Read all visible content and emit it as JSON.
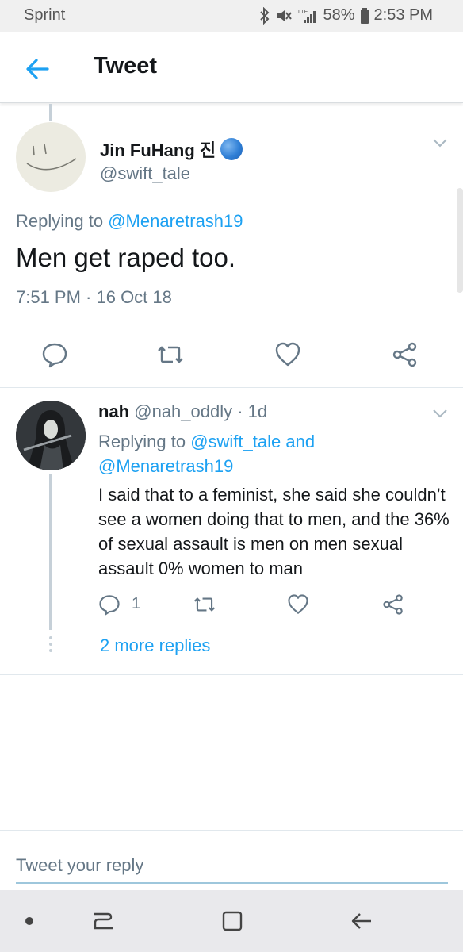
{
  "status_bar": {
    "carrier": "Sprint",
    "network": "LTE",
    "battery": "58%",
    "time": "2:53 PM"
  },
  "header": {
    "title": "Tweet"
  },
  "main_tweet": {
    "author_name": "Jin FuHang 진",
    "handle": "@swift_tale",
    "replying_prefix": "Replying to",
    "replying_to": "@Menaretrash19",
    "text": "Men get raped too.",
    "timestamp": "7:51 PM · 16 Oct 18"
  },
  "reply": {
    "author_name": "nah",
    "handle_time": "@nah_oddly · 1d",
    "replying_prefix": "Replying to",
    "replying_to_1": "@swift_tale",
    "replying_and": "and",
    "replying_to_2": "@Menaretrash19",
    "text": "I said that to a feminist, she said she couldn’t see a women doing that to men, and the 36% of sexual assault is men on men sexual assault 0% women to man",
    "reply_count": "1",
    "more_replies": "2 more replies"
  },
  "composer": {
    "placeholder": "Tweet your reply"
  },
  "colors": {
    "accent": "#1da1f2",
    "secondary_text": "#657786",
    "primary_text": "#14171a"
  }
}
